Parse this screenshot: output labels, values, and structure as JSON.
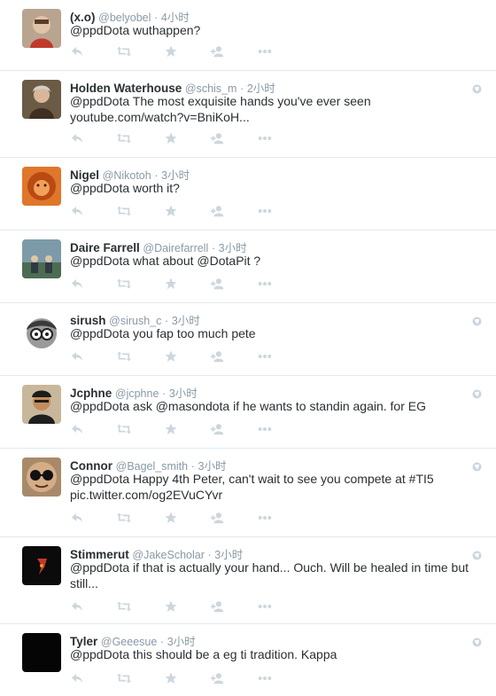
{
  "colors": {
    "name": "#292f33",
    "meta": "#8899a6",
    "icon": "#ccd6dd",
    "divider": "#e1e8ed"
  },
  "icons": [
    "reply-icon",
    "retweet-icon",
    "favorite-icon",
    "follow-icon",
    "more-icon",
    "globe-icon"
  ],
  "tweets": [
    {
      "name": "(x.o)",
      "handle": "@belyobel",
      "sep": "·",
      "time": "4小时",
      "text": "@ppdDota wuthappen?"
    },
    {
      "name": "Holden Waterhouse",
      "handle": "@schis_m",
      "sep": "·",
      "time": "2小时",
      "text": "@ppdDota The most exquisite hands you've ever seen youtube.com/watch?v=BniKoH..."
    },
    {
      "name": "Nigel",
      "handle": "@Nikotoh",
      "sep": "·",
      "time": "3小时",
      "text": "@ppdDota worth it?"
    },
    {
      "name": "Daire Farrell",
      "handle": "@Dairefarrell",
      "sep": "·",
      "time": "3小时",
      "text": "@ppdDota what about @DotaPit ?"
    },
    {
      "name": "sirush",
      "handle": "@sirush_c",
      "sep": "·",
      "time": "3小时",
      "text": "@ppdDota you fap too much pete"
    },
    {
      "name": "Jcphne",
      "handle": "@jcphne",
      "sep": "·",
      "time": "3小时",
      "text": "@ppdDota ask @masondota if he wants to standin again. for EG"
    },
    {
      "name": "Connor",
      "handle": "@Bagel_smith",
      "sep": "·",
      "time": "3小时",
      "text": "@ppdDota Happy 4th Peter, can't wait to see you compete at #TI5 pic.twitter.com/og2EVuCYvr"
    },
    {
      "name": "Stimmerut",
      "handle": "@JakeScholar",
      "sep": "·",
      "time": "3小时",
      "text": "@ppdDota if that is actually your hand... Ouch. Will be healed in time but still..."
    },
    {
      "name": "Tyler",
      "handle": "@Geeesue",
      "sep": "·",
      "time": "3小时",
      "text": "@ppdDota this should be a eg ti tradition. Kappa"
    }
  ]
}
